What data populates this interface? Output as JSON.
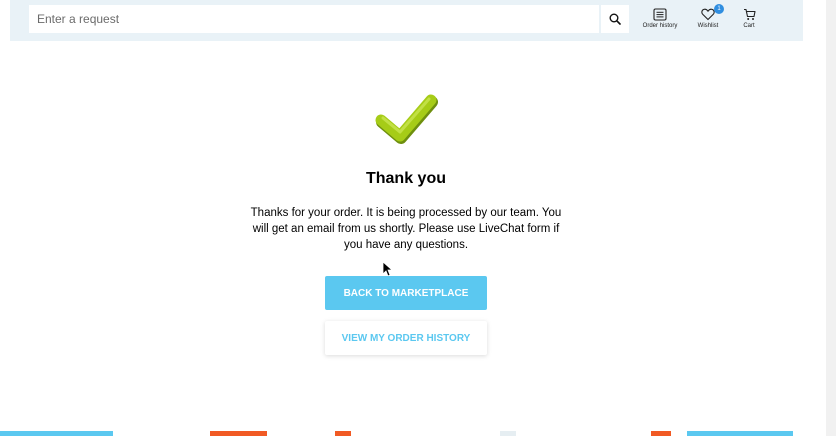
{
  "header": {
    "search_placeholder": "Enter a request",
    "nav": {
      "order_history_label": "Order history",
      "wishlist_label": "Wishlist",
      "wishlist_count": "1",
      "cart_label": "Cart"
    }
  },
  "main": {
    "title": "Thank you",
    "message": "Thanks for your order. It is being processed by our team. You will get an email from us shortly. Please use LiveChat form if you have any questions.",
    "primary_button": "BACK TO MARKETPLACE",
    "secondary_button": "VIEW MY ORDER HISTORY"
  },
  "colors": {
    "accent": "#5bc8f0",
    "header_bg": "#e9f2f7",
    "check": "#a6cc17",
    "badge": "#2f8ee0",
    "footer_orange": "#f15a24"
  }
}
